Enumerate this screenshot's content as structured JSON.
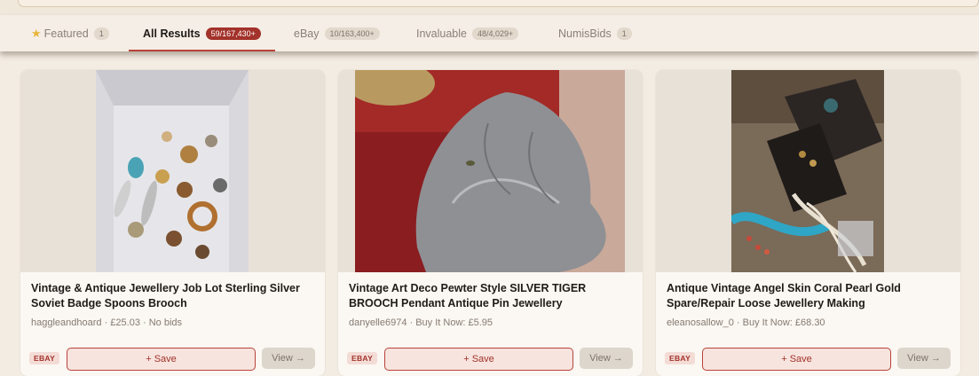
{
  "tabs": [
    {
      "label": "Featured",
      "count": "1",
      "icon": "star-icon"
    },
    {
      "label": "All Results",
      "count": "59/167,430+"
    },
    {
      "label": "eBay",
      "count": "10/163,400+"
    },
    {
      "label": "Invaluable",
      "count": "48/4,029+"
    },
    {
      "label": "NumisBids",
      "count": "1"
    }
  ],
  "active_tab": "All Results",
  "colors": {
    "accent": "#a2322a",
    "background": "#f3ece3",
    "card": "#fbf7f2"
  },
  "cards": [
    {
      "title": "Vintage & Antique Jewellery Job Lot Sterling Silver Soviet Badge Spoons Brooch",
      "meta": "haggleandhoard · £25.03 · No bids",
      "source": "EBAY",
      "save_label": "+ Save",
      "view_label": "View →"
    },
    {
      "title": "Vintage Art Deco Pewter Style SILVER TIGER BROOCH Pendant Antique Pin Jewellery",
      "meta": "danyelle6974 · Buy It Now: £5.95",
      "source": "EBAY",
      "save_label": "+ Save",
      "view_label": "View →"
    },
    {
      "title": "Antique Vintage Angel Skin Coral Pearl Gold Spare/Repair Loose Jewellery Making",
      "meta": "eleanosallow_0 · Buy It Now: £68.30",
      "source": "EBAY",
      "save_label": "+ Save",
      "view_label": "View →"
    }
  ]
}
